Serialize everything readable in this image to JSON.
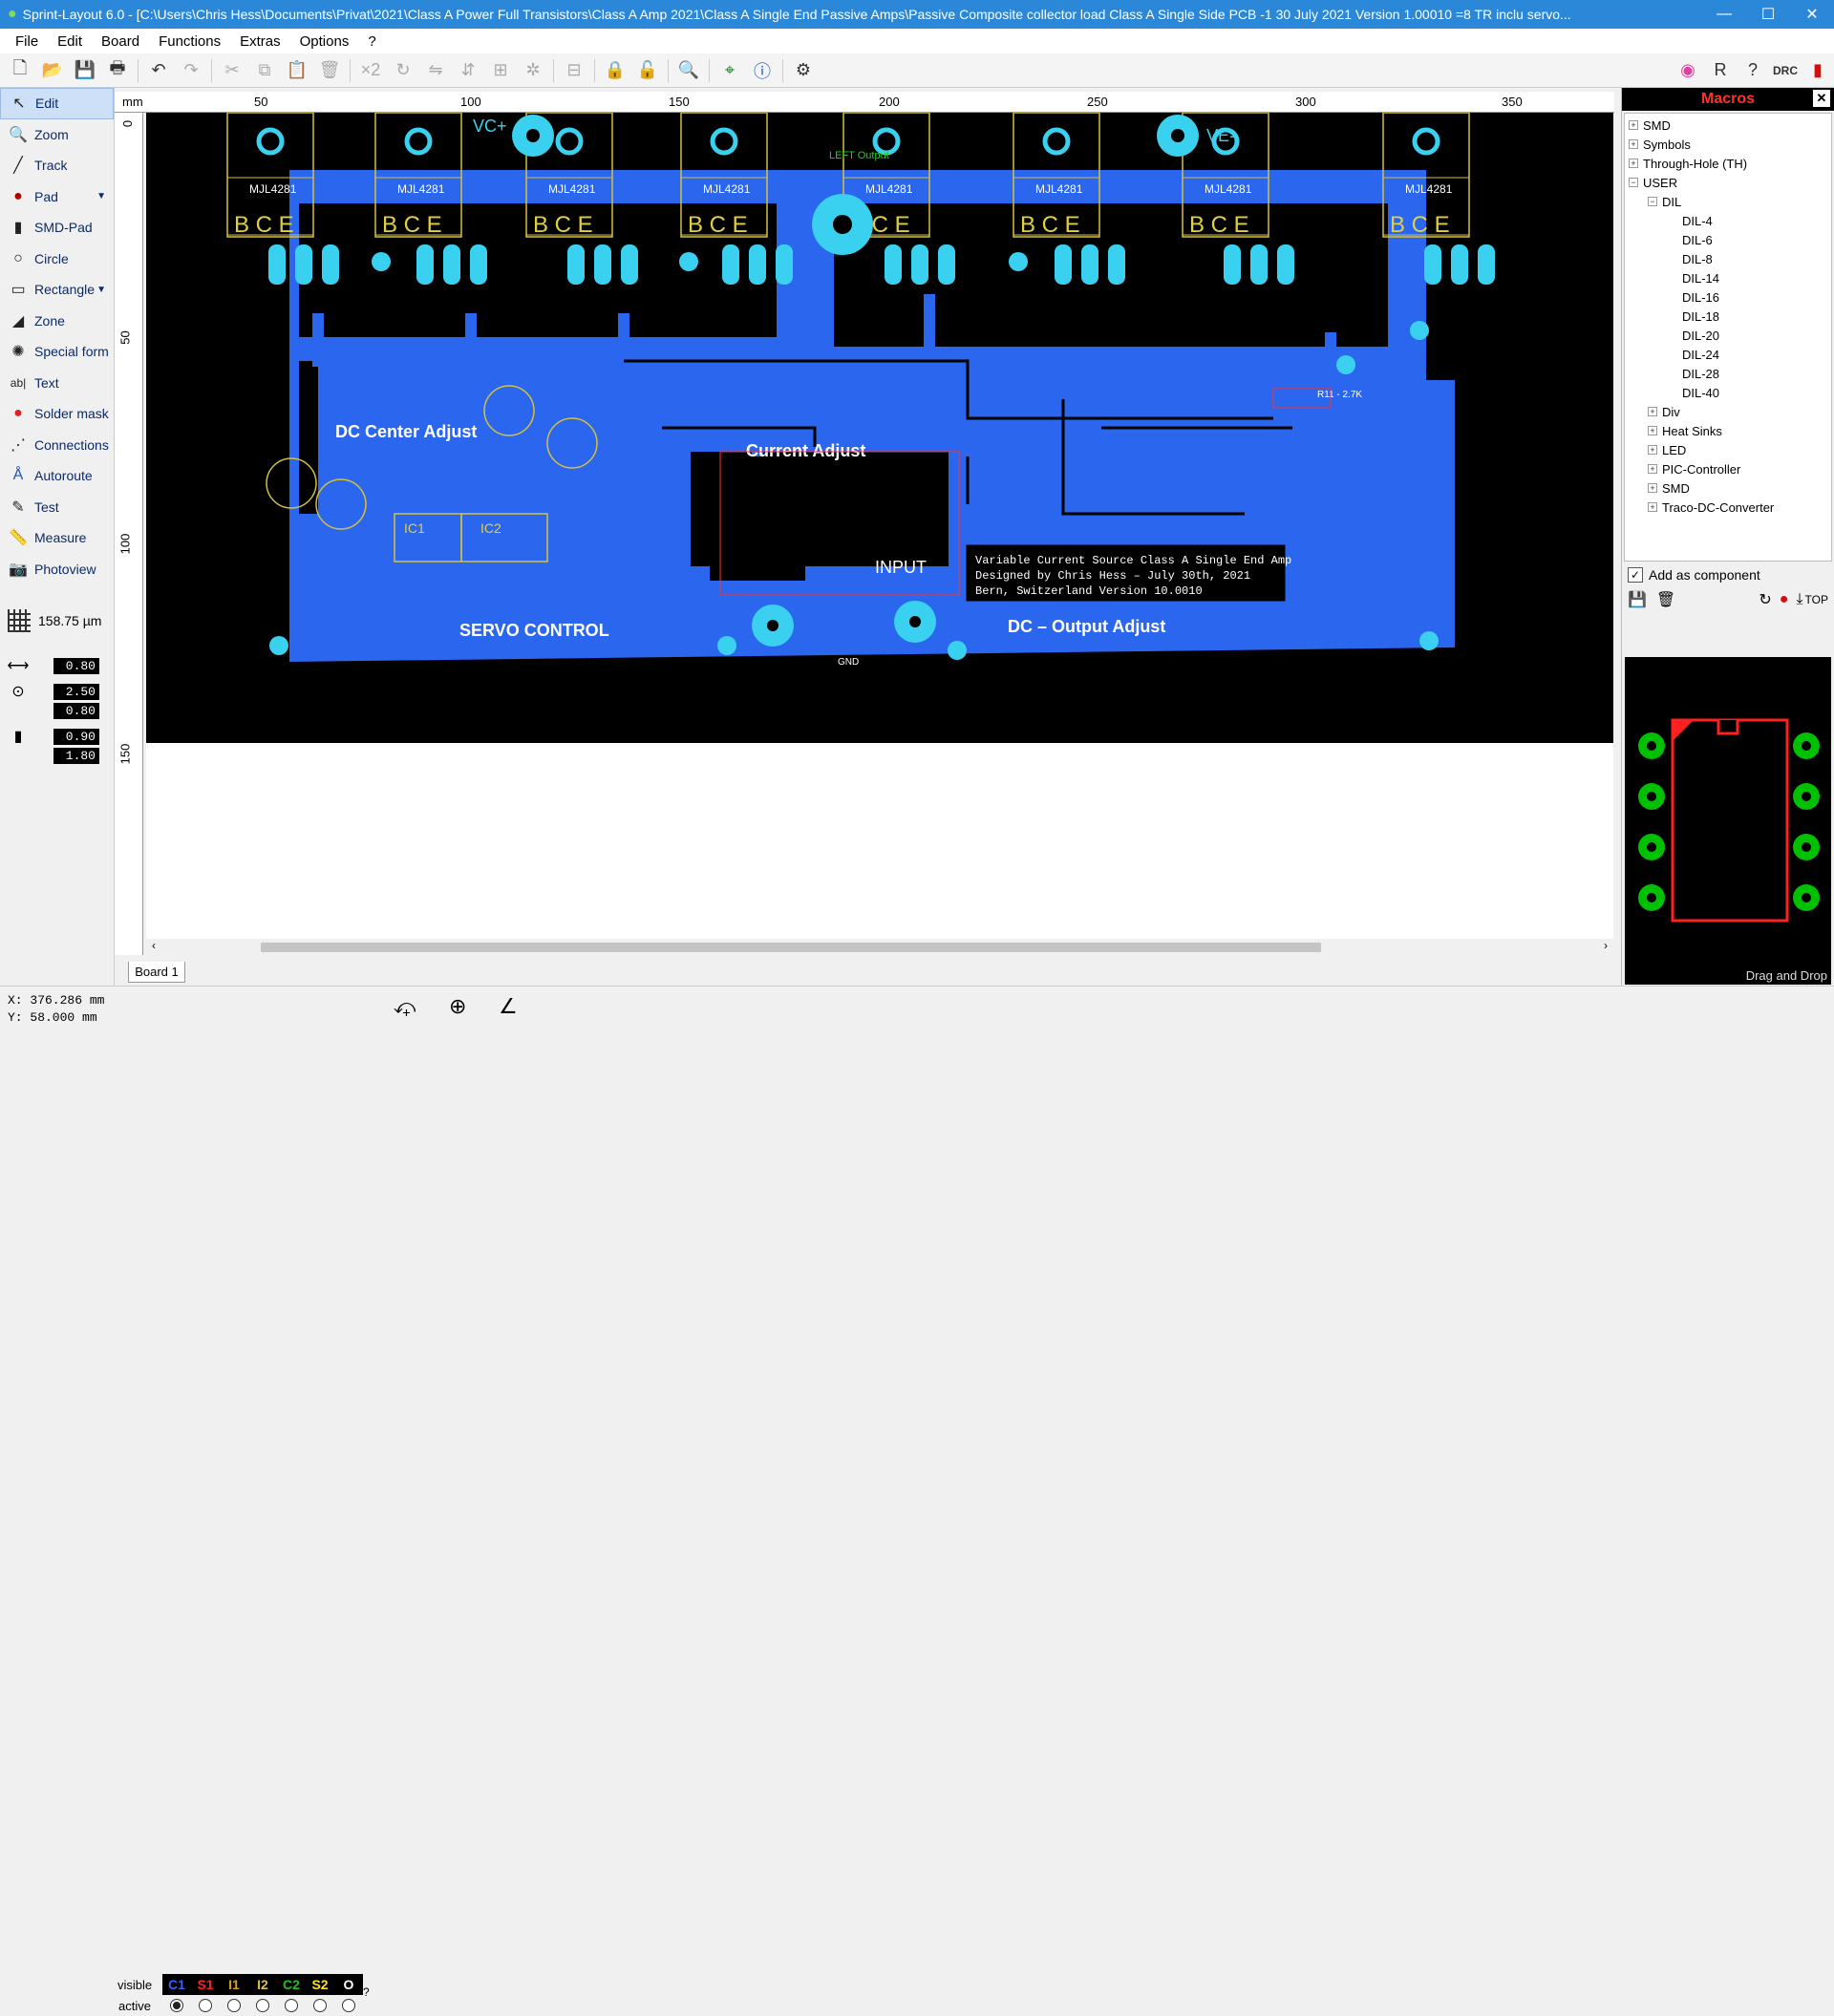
{
  "window": {
    "title": "Sprint-Layout 6.0 - [C:\\Users\\Chris Hess\\Documents\\Privat\\2021\\Class A Power Full Transistors\\Class A Amp 2021\\Class A Single End Passive Amps\\Passive Composite collector load Class A Single Side PCB -1 30 July 2021 Version 1.00010 =8 TR inclu servo...",
    "minimize": "—",
    "maximize": "☐",
    "close": "✕"
  },
  "menu": [
    "File",
    "Edit",
    "Board",
    "Functions",
    "Extras",
    "Options",
    "?"
  ],
  "toolbar": {
    "zoom_factor": "×2"
  },
  "tools": [
    {
      "label": "Edit",
      "icon": "cursor-icon"
    },
    {
      "label": "Zoom",
      "icon": "magnifier-icon"
    },
    {
      "label": "Track",
      "icon": "track-icon"
    },
    {
      "label": "Pad",
      "icon": "pad-icon"
    },
    {
      "label": "SMD-Pad",
      "icon": "smd-pad-icon"
    },
    {
      "label": "Circle",
      "icon": "circle-icon"
    },
    {
      "label": "Rectangle",
      "icon": "rectangle-icon"
    },
    {
      "label": "Zone",
      "icon": "zone-icon"
    },
    {
      "label": "Special form",
      "icon": "special-form-icon"
    },
    {
      "label": "Text",
      "icon": "text-icon"
    },
    {
      "label": "Solder mask",
      "icon": "solder-mask-icon"
    },
    {
      "label": "Connections",
      "icon": "connections-icon"
    },
    {
      "label": "Autoroute",
      "icon": "autoroute-icon"
    },
    {
      "label": "Test",
      "icon": "test-icon"
    },
    {
      "label": "Measure",
      "icon": "measure-icon"
    },
    {
      "label": "Photoview",
      "icon": "camera-icon"
    }
  ],
  "grid": {
    "value": "158.75 µm"
  },
  "params": {
    "track_width": "0.80",
    "pad_outer": "2.50",
    "pad_inner": "0.80",
    "smd_w": "0.90",
    "smd_h": "1.80"
  },
  "ruler": {
    "unit": "mm",
    "top_ticks": [
      "50",
      "100",
      "150",
      "200",
      "250",
      "300",
      "350"
    ],
    "left_ticks": [
      "0",
      "50",
      "100",
      "150"
    ]
  },
  "board": {
    "transistor_label": "MJL4281",
    "bce": "B C E",
    "vc_plus": "VC+",
    "ve_minus": "VE-",
    "left_output": "LEFT\nOutput",
    "dc_center": "DC Center Adjust",
    "current_adjust": "Current Adjust",
    "input": "INPUT",
    "servo": "SERVO CONTROL",
    "dc_output": "DC – Output Adjust",
    "gnd": "GND",
    "ic1": "IC1",
    "ic2": "IC2",
    "info_line1": "Variable Current Source Class A Single End Amp",
    "info_line2": "Designed by Chris Hess – July 30th, 2021",
    "info_line3": "Bern, Switzerland   Version 10.0010",
    "r11": "R11 - 2.7K"
  },
  "board_tab": "Board 1",
  "status": {
    "x": "X:  376.286 mm",
    "y": "Y:   58.000 mm",
    "visible": "visible",
    "active": "active",
    "help": "?"
  },
  "layers": [
    {
      "name": "C1",
      "color": "#3a5fff",
      "active": true
    },
    {
      "name": "S1",
      "color": "#ff2020",
      "active": false
    },
    {
      "name": "I1",
      "color": "#d4a020",
      "active": false
    },
    {
      "name": "I2",
      "color": "#e0c040",
      "active": false
    },
    {
      "name": "C2",
      "color": "#20c020",
      "active": false
    },
    {
      "name": "S2",
      "color": "#ffe020",
      "active": false
    },
    {
      "name": "O",
      "color": "#ffffff",
      "active": false
    }
  ],
  "macros": {
    "title": "Macros",
    "tree": [
      {
        "label": "SMD",
        "level": 0,
        "exp": "+"
      },
      {
        "label": "Symbols",
        "level": 0,
        "exp": "+"
      },
      {
        "label": "Through-Hole (TH)",
        "level": 0,
        "exp": "+"
      },
      {
        "label": "USER",
        "level": 0,
        "exp": "−"
      },
      {
        "label": "DIL",
        "level": 1,
        "exp": "−"
      },
      {
        "label": "DIL-4",
        "level": 2,
        "exp": ""
      },
      {
        "label": "DIL-6",
        "level": 2,
        "exp": ""
      },
      {
        "label": "DIL-8",
        "level": 2,
        "exp": ""
      },
      {
        "label": "DIL-14",
        "level": 2,
        "exp": ""
      },
      {
        "label": "DIL-16",
        "level": 2,
        "exp": ""
      },
      {
        "label": "DIL-18",
        "level": 2,
        "exp": ""
      },
      {
        "label": "DIL-20",
        "level": 2,
        "exp": ""
      },
      {
        "label": "DIL-24",
        "level": 2,
        "exp": ""
      },
      {
        "label": "DIL-28",
        "level": 2,
        "exp": ""
      },
      {
        "label": "DIL-40",
        "level": 2,
        "exp": ""
      },
      {
        "label": "Div",
        "level": 1,
        "exp": "+"
      },
      {
        "label": "Heat Sinks",
        "level": 1,
        "exp": "+"
      },
      {
        "label": "LED",
        "level": 1,
        "exp": "+"
      },
      {
        "label": "PIC-Controller",
        "level": 1,
        "exp": "+"
      },
      {
        "label": "SMD",
        "level": 1,
        "exp": "+"
      },
      {
        "label": "Traco-DC-Converter",
        "level": 1,
        "exp": "+"
      }
    ],
    "add_as_component": "Add as component",
    "top_label": "TOP",
    "drag_drop": "Drag and Drop"
  }
}
